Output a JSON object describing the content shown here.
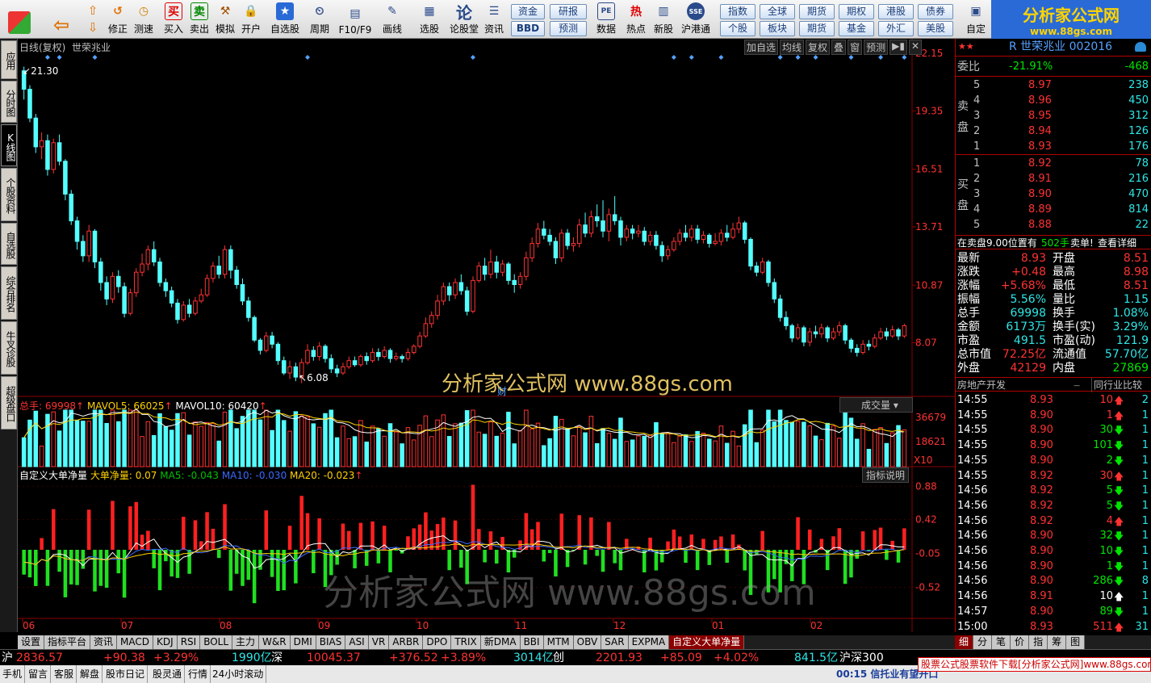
{
  "toolbar": {
    "buttons": [
      "修正",
      "测速",
      "买入",
      "卖出",
      "模拟",
      "开户",
      "自选股",
      "周期",
      "F10/F9",
      "画线",
      "选股",
      "论股堂",
      "资讯",
      "数据",
      "热点",
      "新股",
      "沪港通",
      "自定"
    ],
    "small_buttons": [
      "资金",
      "研报",
      "BBD",
      "预测",
      "指数",
      "全球",
      "期货",
      "期权",
      "港股",
      "债券",
      "个股",
      "板块",
      "期货",
      "基金",
      "外汇",
      "美股"
    ],
    "icon_glyphs": {
      "back": "⇦",
      "up": "⇧",
      "down": "⇩",
      "repair": "↺",
      "speed": "◷",
      "buy": "买",
      "sell": "卖",
      "sim": "⚒",
      "open": "🔒",
      "fav": "★",
      "period": "⏲",
      "f10": "▤",
      "draw": "✎",
      "select": "▦",
      "forum": "论",
      "news": "☰",
      "data": "PE",
      "hot": "热",
      "newstock": "▥",
      "hk": "SSE"
    }
  },
  "logo": {
    "name": "分析家公式网",
    "url": "www.88gs.com"
  },
  "sidetabs": [
    "应用",
    "分时图",
    "K线图",
    "个股资料",
    "自选股",
    "综合排名",
    "牛叉诊股",
    "超级盘口"
  ],
  "chart_header": {
    "title": "日线(复权)",
    "stock": "世荣兆业",
    "buttons": [
      "加自选",
      "均线",
      "复权",
      "叠",
      "窗",
      "预测"
    ]
  },
  "price_labels": {
    "high": "21.30",
    "low": "6.08"
  },
  "vol_header": {
    "total": "总手: 69998",
    "mavol5": "MAVOL5: 66025",
    "mavol10": "MAVOL10: 60420",
    "indicator": "成交量",
    "unit": "X10"
  },
  "ind_header": {
    "name": "自定义大单净量",
    "value": "大单净量: 0.07",
    "ma5": "MA5: -0.043",
    "ma10": "MA10: -0.030",
    "ma20": "MA20: -0.023",
    "help": "指标说明"
  },
  "x_labels": [
    "06",
    "07",
    "08",
    "09",
    "10",
    "11",
    "12",
    "01",
    "02"
  ],
  "cai_label": "财",
  "watermark": {
    "mid": "分析家公式网  www.88gs.com",
    "low": "分析家公式网  www.88gs.com"
  },
  "chart_data": {
    "type": "candlestick",
    "title": "日线(复权) 世荣兆业",
    "price_axis": [
      "22.15",
      "19.35",
      "16.51",
      "13.71",
      "10.87",
      "8.07"
    ],
    "price_range": [
      5.5,
      22.15
    ],
    "vol_axis": [
      "36679",
      "18621"
    ],
    "vol_range": [
      0,
      40000
    ],
    "ind_axis": [
      "0.88",
      "0.42",
      "-0.05",
      "-0.52"
    ],
    "ind_range": [
      -0.95,
      0.95
    ],
    "months": [
      "06",
      "07",
      "08",
      "09",
      "10",
      "11",
      "12",
      "01",
      "02"
    ],
    "candles": [
      [
        21.3,
        20.4,
        21.5,
        19.9
      ],
      [
        20.4,
        19.0,
        20.6,
        18.8
      ],
      [
        19.0,
        17.6,
        19.2,
        17.3
      ],
      [
        17.6,
        17.9,
        18.3,
        17.0
      ],
      [
        17.9,
        16.5,
        18.2,
        16.2
      ],
      [
        16.5,
        17.8,
        18.0,
        16.3
      ],
      [
        17.8,
        16.9,
        18.2,
        16.7
      ],
      [
        16.9,
        15.3,
        17.0,
        15.0
      ],
      [
        15.3,
        14.0,
        15.5,
        13.8
      ],
      [
        14.0,
        13.0,
        14.2,
        12.6
      ],
      [
        13.0,
        12.3,
        13.3,
        12.0
      ],
      [
        12.3,
        13.5,
        13.8,
        12.0
      ],
      [
        13.5,
        12.0,
        13.6,
        11.7
      ],
      [
        12.0,
        11.0,
        12.2,
        10.6
      ],
      [
        11.0,
        10.2,
        11.3,
        9.9
      ],
      [
        10.2,
        11.3,
        11.5,
        10.0
      ],
      [
        11.3,
        10.8,
        11.6,
        10.5
      ],
      [
        10.8,
        9.5,
        11.0,
        9.3
      ],
      [
        9.5,
        10.5,
        10.7,
        9.4
      ],
      [
        10.5,
        11.5,
        11.7,
        10.3
      ],
      [
        11.5,
        11.9,
        12.4,
        11.3
      ],
      [
        11.9,
        12.6,
        12.8,
        11.6
      ],
      [
        12.6,
        12.0,
        13.0,
        11.8
      ],
      [
        12.0,
        11.0,
        12.2,
        10.8
      ],
      [
        11.0,
        10.6,
        11.2,
        10.3
      ],
      [
        10.6,
        10.0,
        10.8,
        9.8
      ],
      [
        10.0,
        9.2,
        10.2,
        9.0
      ],
      [
        9.2,
        9.9,
        10.1,
        9.1
      ],
      [
        9.9,
        9.5,
        10.2,
        9.3
      ],
      [
        9.5,
        10.1,
        10.3,
        9.4
      ],
      [
        10.1,
        10.4,
        10.7,
        10.0
      ],
      [
        10.4,
        11.2,
        11.4,
        10.3
      ],
      [
        11.2,
        11.8,
        12.0,
        11.0
      ],
      [
        11.8,
        11.4,
        12.3,
        11.2
      ],
      [
        11.4,
        12.6,
        12.8,
        11.2
      ],
      [
        12.6,
        11.6,
        12.8,
        11.2
      ],
      [
        11.6,
        10.9,
        11.8,
        10.7
      ],
      [
        10.9,
        10.1,
        11.2,
        9.9
      ],
      [
        10.1,
        9.3,
        10.3,
        9.1
      ],
      [
        9.3,
        8.2,
        9.4,
        8.1
      ],
      [
        8.2,
        7.7,
        8.3,
        7.5
      ],
      [
        7.7,
        8.4,
        8.6,
        7.6
      ],
      [
        8.4,
        8.0,
        8.6,
        7.8
      ],
      [
        8.0,
        7.2,
        8.1,
        7.0
      ],
      [
        7.2,
        6.6,
        7.4,
        6.5
      ],
      [
        6.6,
        6.9,
        7.2,
        6.3
      ],
      [
        6.9,
        6.4,
        7.1,
        6.2
      ],
      [
        6.4,
        7.1,
        7.3,
        6.1
      ],
      [
        7.1,
        7.7,
        8.0,
        7.0
      ],
      [
        7.7,
        7.4,
        7.9,
        7.2
      ],
      [
        7.4,
        7.9,
        8.1,
        7.2
      ],
      [
        7.9,
        7.3,
        8.0,
        7.1
      ],
      [
        7.3,
        6.8,
        7.5,
        6.6
      ],
      [
        6.8,
        6.6,
        7.0,
        6.4
      ],
      [
        6.6,
        6.9,
        7.1,
        6.5
      ],
      [
        6.9,
        7.2,
        7.4,
        6.8
      ],
      [
        7.2,
        7.0,
        7.4,
        6.9
      ],
      [
        7.0,
        7.4,
        7.5,
        6.9
      ],
      [
        7.4,
        7.2,
        7.6,
        7.0
      ],
      [
        7.2,
        7.6,
        7.8,
        7.1
      ],
      [
        7.6,
        7.4,
        7.8,
        7.2
      ],
      [
        7.4,
        7.7,
        7.9,
        7.3
      ],
      [
        7.7,
        7.3,
        7.8,
        7.1
      ],
      [
        7.3,
        7.4,
        7.6,
        7.2
      ],
      [
        7.4,
        7.3,
        7.5,
        7.1
      ],
      [
        7.3,
        7.6,
        7.8,
        7.2
      ],
      [
        7.6,
        7.9,
        8.0,
        7.5
      ],
      [
        7.9,
        8.4,
        8.6,
        7.8
      ],
      [
        8.4,
        9.0,
        9.3,
        8.3
      ],
      [
        9.0,
        9.4,
        9.6,
        8.8
      ],
      [
        9.4,
        10.1,
        10.4,
        9.2
      ],
      [
        10.1,
        10.8,
        11.0,
        9.9
      ],
      [
        10.8,
        10.4,
        11.0,
        10.1
      ],
      [
        10.4,
        11.0,
        11.2,
        10.2
      ],
      [
        11.0,
        10.6,
        11.4,
        10.4
      ],
      [
        10.6,
        9.6,
        10.8,
        9.4
      ],
      [
        9.6,
        11.1,
        11.3,
        9.5
      ],
      [
        11.1,
        11.8,
        12.0,
        11.0
      ],
      [
        11.8,
        11.4,
        12.2,
        11.1
      ],
      [
        11.4,
        12.0,
        12.6,
        11.2
      ],
      [
        12.0,
        11.5,
        12.3,
        11.2
      ],
      [
        11.5,
        11.9,
        12.1,
        11.3
      ],
      [
        11.9,
        11.1,
        12.0,
        10.9
      ],
      [
        11.1,
        10.9,
        11.4,
        10.5
      ],
      [
        10.9,
        11.3,
        11.5,
        10.7
      ],
      [
        11.3,
        12.2,
        12.5,
        11.1
      ],
      [
        12.2,
        12.9,
        13.2,
        12.0
      ],
      [
        12.9,
        13.6,
        13.9,
        12.7
      ],
      [
        13.6,
        13.3,
        14.0,
        13.1
      ],
      [
        13.3,
        13.0,
        13.6,
        12.8
      ],
      [
        13.0,
        12.2,
        13.2,
        11.9
      ],
      [
        12.2,
        13.4,
        13.6,
        12.0
      ],
      [
        13.4,
        12.8,
        13.6,
        12.6
      ],
      [
        12.8,
        12.9,
        13.2,
        12.5
      ],
      [
        12.9,
        13.8,
        14.1,
        12.7
      ],
      [
        13.8,
        13.4,
        14.4,
        13.2
      ],
      [
        13.4,
        14.2,
        14.5,
        13.2
      ],
      [
        14.2,
        14.0,
        14.8,
        13.7
      ],
      [
        14.0,
        13.5,
        15.0,
        13.2
      ],
      [
        13.5,
        14.3,
        14.6,
        13.0
      ],
      [
        14.3,
        14.0,
        15.2,
        13.8
      ],
      [
        14.0,
        13.2,
        14.2,
        12.8
      ],
      [
        13.2,
        13.6,
        13.8,
        13.0
      ],
      [
        13.6,
        13.4,
        13.8,
        13.1
      ],
      [
        13.4,
        13.5,
        13.8,
        13.2
      ],
      [
        13.5,
        13.0,
        13.7,
        12.8
      ],
      [
        13.0,
        13.3,
        13.5,
        12.8
      ],
      [
        13.3,
        12.8,
        13.5,
        12.6
      ],
      [
        12.8,
        12.3,
        13.0,
        12.0
      ],
      [
        12.3,
        12.6,
        12.8,
        12.1
      ],
      [
        12.6,
        13.0,
        13.2,
        12.5
      ],
      [
        13.0,
        13.4,
        13.6,
        12.8
      ],
      [
        13.4,
        13.2,
        13.8,
        13.0
      ],
      [
        13.2,
        13.6,
        13.8,
        13.0
      ],
      [
        13.6,
        13.1,
        13.8,
        12.9
      ],
      [
        13.1,
        13.3,
        13.5,
        12.9
      ],
      [
        13.3,
        12.9,
        13.4,
        12.7
      ],
      [
        12.9,
        13.0,
        13.4,
        12.8
      ],
      [
        13.0,
        13.4,
        13.6,
        12.8
      ],
      [
        13.4,
        13.2,
        13.8,
        13.0
      ],
      [
        13.2,
        13.6,
        13.9,
        13.1
      ],
      [
        13.6,
        13.9,
        14.2,
        13.4
      ],
      [
        13.9,
        13.1,
        14.0,
        12.9
      ],
      [
        13.1,
        11.8,
        13.2,
        11.6
      ],
      [
        11.8,
        11.5,
        12.0,
        11.3
      ],
      [
        11.5,
        12.0,
        12.2,
        11.4
      ],
      [
        12.0,
        11.0,
        12.1,
        10.8
      ],
      [
        11.0,
        10.2,
        11.2,
        10.0
      ],
      [
        10.2,
        9.3,
        10.4,
        9.1
      ],
      [
        9.3,
        8.9,
        9.6,
        8.7
      ],
      [
        8.9,
        8.3,
        9.0,
        8.1
      ],
      [
        8.3,
        8.8,
        9.0,
        8.2
      ],
      [
        8.8,
        8.1,
        8.9,
        7.9
      ],
      [
        8.1,
        8.6,
        8.8,
        7.9
      ],
      [
        8.6,
        8.5,
        8.9,
        8.3
      ],
      [
        8.5,
        8.8,
        9.0,
        8.3
      ],
      [
        8.8,
        8.3,
        8.9,
        8.1
      ],
      [
        8.3,
        8.6,
        8.8,
        8.2
      ],
      [
        8.6,
        8.9,
        9.1,
        8.4
      ],
      [
        8.9,
        8.2,
        9.0,
        8.0
      ],
      [
        8.2,
        7.8,
        8.3,
        7.6
      ],
      [
        7.8,
        7.6,
        8.0,
        7.4
      ],
      [
        7.6,
        8.0,
        8.2,
        7.5
      ],
      [
        8.0,
        7.9,
        8.2,
        7.7
      ],
      [
        7.9,
        8.3,
        8.5,
        7.8
      ],
      [
        8.3,
        8.6,
        8.8,
        8.2
      ],
      [
        8.6,
        8.4,
        8.8,
        8.2
      ],
      [
        8.4,
        8.7,
        8.9,
        8.3
      ],
      [
        8.7,
        8.4,
        8.8,
        8.2
      ],
      [
        8.4,
        8.9,
        9.0,
        8.3
      ]
    ]
  },
  "right_panel": {
    "title": "R 世荣兆业 002016",
    "webi_label": "委比",
    "webi_pct": "-21.91%",
    "webi_diff": "-468",
    "sell_label": "卖盘",
    "buy_label": "买盘",
    "asks": [
      [
        "5",
        "8.97",
        "238"
      ],
      [
        "4",
        "8.96",
        "450"
      ],
      [
        "3",
        "8.95",
        "312"
      ],
      [
        "2",
        "8.94",
        "126"
      ],
      [
        "1",
        "8.93",
        "176"
      ]
    ],
    "bids": [
      [
        "1",
        "8.92",
        "78"
      ],
      [
        "2",
        "8.91",
        "216"
      ],
      [
        "3",
        "8.90",
        "470"
      ],
      [
        "4",
        "8.89",
        "814"
      ],
      [
        "5",
        "8.88",
        "22"
      ]
    ],
    "notice": "在卖盘9.00位置有",
    "notice_hands": "502手",
    "notice_sell": "卖单!",
    "notice_detail": "查看详细",
    "stats": [
      [
        "最新",
        "8.93",
        "开盘",
        "8.51"
      ],
      [
        "涨跌",
        "+0.48",
        "最高",
        "8.98"
      ],
      [
        "涨幅",
        "+5.68%",
        "最低",
        "8.51"
      ],
      [
        "振幅",
        "5.56%",
        "量比",
        "1.15"
      ],
      [
        "总手",
        "69998",
        "换手",
        "1.08%"
      ],
      [
        "金额",
        "6173万",
        "换手(实)",
        "3.29%"
      ],
      [
        "市盈",
        "491.5",
        "市盈(动)",
        "121.9"
      ],
      [
        "总市值",
        "72.25亿",
        "流通值",
        "57.70亿"
      ],
      [
        "外盘",
        "42129",
        "内盘",
        "27869"
      ]
    ],
    "sector": "房地产开发",
    "compare": "同行业比较",
    "ticks": [
      [
        "14:55",
        "8.93",
        "10",
        "up",
        "2"
      ],
      [
        "14:55",
        "8.90",
        "1",
        "up",
        "1"
      ],
      [
        "14:55",
        "8.90",
        "30",
        "down",
        "1"
      ],
      [
        "14:55",
        "8.90",
        "101",
        "down",
        "1"
      ],
      [
        "14:55",
        "8.90",
        "2",
        "down",
        "1"
      ],
      [
        "14:55",
        "8.92",
        "30",
        "up",
        "1"
      ],
      [
        "14:56",
        "8.92",
        "5",
        "down",
        "1"
      ],
      [
        "14:56",
        "8.92",
        "5",
        "down",
        "1"
      ],
      [
        "14:56",
        "8.92",
        "4",
        "up",
        "1"
      ],
      [
        "14:56",
        "8.90",
        "32",
        "down",
        "1"
      ],
      [
        "14:56",
        "8.90",
        "10",
        "down",
        "1"
      ],
      [
        "14:56",
        "8.90",
        "1",
        "down",
        "1"
      ],
      [
        "14:56",
        "8.90",
        "286",
        "down",
        "8"
      ],
      [
        "14:56",
        "8.91",
        "10",
        "white",
        "1"
      ],
      [
        "14:57",
        "8.90",
        "89",
        "down",
        "1"
      ],
      [
        "15:00",
        "8.93",
        "511",
        "up",
        "31"
      ]
    ]
  },
  "bottom_tabs": [
    "设置",
    "指标平台",
    "资讯",
    "MACD",
    "KDJ",
    "RSI",
    "BOLL",
    "主力",
    "W&R",
    "DMI",
    "BIAS",
    "ASI",
    "VR",
    "ARBR",
    "DPO",
    "TRIX",
    "新DMA",
    "BBI",
    "MTM",
    "OBV",
    "SAR",
    "EXPMA",
    "自定义大单净量"
  ],
  "right_bottom_tabs": [
    "细",
    "分",
    "笔",
    "价",
    "指",
    "筹",
    "图"
  ],
  "ticker": {
    "sh": "沪",
    "sh_val": "2836.57",
    "sh_chg": "+90.38",
    "sh_pct": "+3.29%",
    "sh_amt": "1990亿",
    "sz": "深",
    "sz_val": "10045.37",
    "sz_chg": "+376.52",
    "sz_pct": "+3.89%",
    "sz_amt": "3014亿",
    "cy": "创",
    "cy_val": "2201.93",
    "cy_chg": "+85.09",
    "cy_pct": "+4.02%",
    "cy_amt": "841.5亿",
    "hs": "沪深300"
  },
  "statusbar": {
    "items": [
      "手机",
      "留言",
      "客服",
      "解盘",
      "股市日记",
      "股灵通",
      "行情",
      "24小时滚动"
    ],
    "news": "00:15 信托业有望开口",
    "banner": "股票公式股票软件下载[分析家公式网]www.88gs.com"
  },
  "colors": {
    "up": "#ff3232",
    "down": "#54ffff",
    "ind_up": "#ff2020",
    "ind_down": "#20e020",
    "ma5": "#ffffff",
    "ma10": "#ffd200",
    "ma20": "#d040d0",
    "grid": "#8b0000"
  }
}
